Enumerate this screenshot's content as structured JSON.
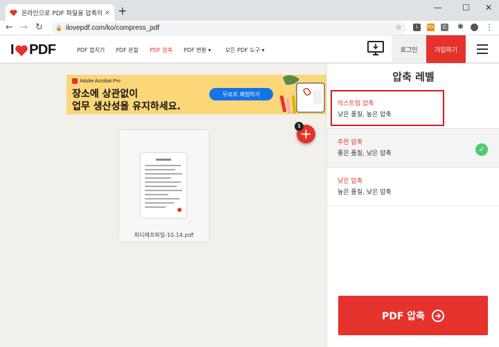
{
  "browser": {
    "tab_title": "온라인으로 PDF 파일을 압축하세",
    "tab_close": "×",
    "new_tab": "+",
    "url": "ilovepdf.com/ko/compress_pdf",
    "window_controls": {
      "minimize": "—",
      "maximize": "☐",
      "close": "✕"
    },
    "extensions": [
      "I",
      "RX",
      "C",
      "S"
    ]
  },
  "site_nav": {
    "logo_left": "I",
    "logo_right": "PDF",
    "menu": [
      {
        "label": "PDF 합치기",
        "active": false
      },
      {
        "label": "PDF 분할",
        "active": false
      },
      {
        "label": "PDF 압축",
        "active": true
      },
      {
        "label": "PDF 변환 ▾",
        "active": false
      },
      {
        "label": "모든 PDF 도구 ▾",
        "active": false
      }
    ],
    "login": "로그인",
    "signup": "가입하기"
  },
  "ad": {
    "brand": "Adobe Acrobat Pro",
    "line1": "장소에 상관없이",
    "line2": "업무 생산성을 유지하세요.",
    "cta": "무료로 체험하기"
  },
  "file": {
    "name": "피디에프파일-10.14.pdf",
    "count_badge": "1",
    "add": "+"
  },
  "sidebar": {
    "heading": "압축 레벨",
    "options": [
      {
        "name": "익스트림 압축",
        "desc": "낮은 품질, 높은 압축",
        "selected": false
      },
      {
        "name": "추천 압축",
        "desc": "좋은 품질, 낮은 압축",
        "selected": true
      },
      {
        "name": "낮은 압축",
        "desc": "높은 품질, 낮은 압축",
        "selected": false
      }
    ],
    "compress_button": "PDF 압축"
  },
  "colors": {
    "brand_red": "#e5322d",
    "check_green": "#4ecb71",
    "ad_yellow": "#fcd77a",
    "ad_blue": "#1473e6",
    "highlight_box": "#d9151f"
  }
}
